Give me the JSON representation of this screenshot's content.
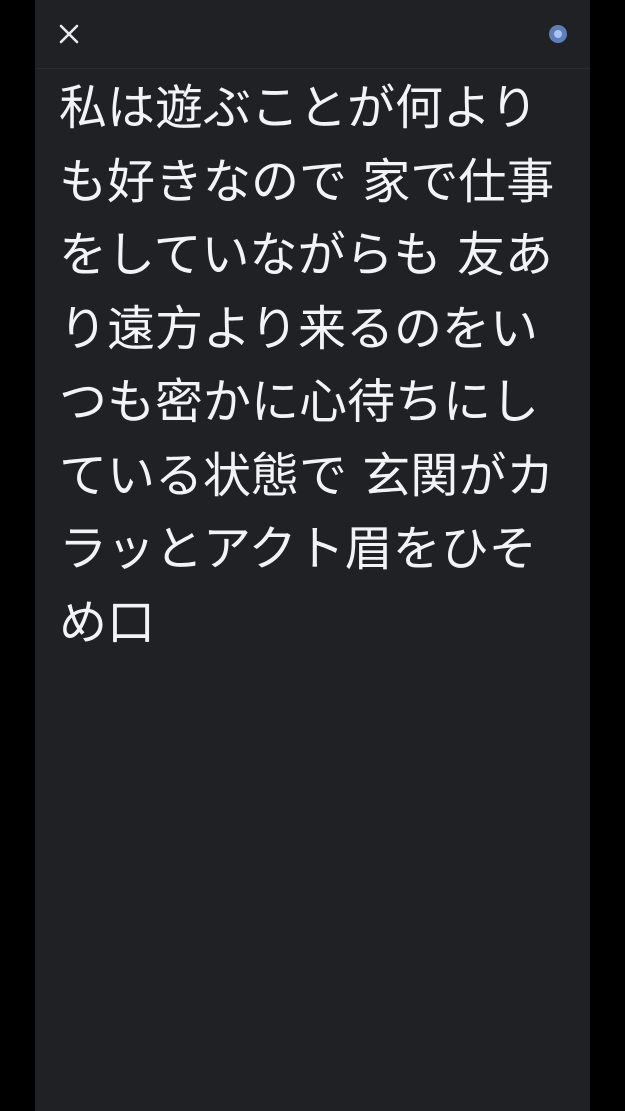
{
  "topbar": {
    "close_icon": "close-icon",
    "status_icon": "recording-indicator-icon"
  },
  "colors": {
    "background": "#202124",
    "outer_background": "#000000",
    "text": "#f1f3f4",
    "indicator_outer": "#5f7fb8",
    "indicator_inner": "#aac4f2"
  },
  "transcript": {
    "text": "私は遊ぶことが何よりも好きなので 家で仕事をしていながらも 友あり遠方より来るのをいつも密かに心待ちにしている状態で 玄関がカラッとアクト眉をひそめ口"
  }
}
